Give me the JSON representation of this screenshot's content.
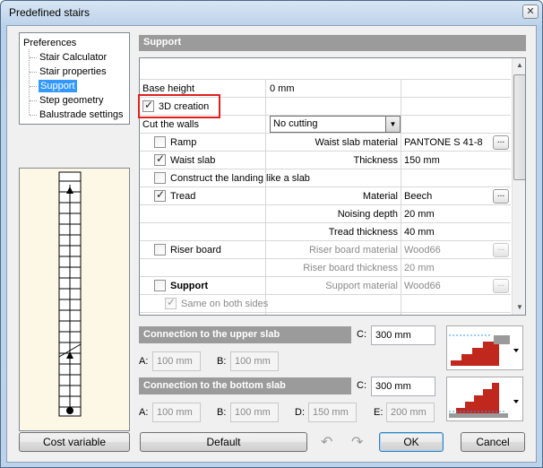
{
  "window": {
    "title": "Predefined stairs"
  },
  "tree": {
    "root": "Preferences",
    "items": [
      "Stair Calculator",
      "Stair properties",
      "Support",
      "Step geometry",
      "Balustrade settings"
    ]
  },
  "support": {
    "header": "Support",
    "rows": {
      "base_height_label": "Base height",
      "base_height_value": "0 mm",
      "creation_3d_label": "3D creation",
      "cut_walls_label": "Cut the walls",
      "cut_walls_value": "No cutting",
      "ramp_label": "Ramp",
      "waist_slab_material_label": "Waist slab material",
      "waist_slab_material_value": "PANTONE S 41-8",
      "waist_slab_label": "Waist slab",
      "thickness_label": "Thickness",
      "thickness_value": "150 mm",
      "landing_slab_label": "Construct the landing like a slab",
      "tread_label": "Tread",
      "material_label": "Material",
      "material_value": "Beech",
      "noising_depth_label": "Noising depth",
      "noising_depth_value": "20 mm",
      "tread_thickness_label": "Tread thickness",
      "tread_thickness_value": "40 mm",
      "riser_board_label": "Riser board",
      "riser_board_material_label": "Riser board material",
      "riser_board_material_value": "Wood66",
      "riser_board_thickness_label": "Riser board thickness",
      "riser_board_thickness_value": "20 mm",
      "support_label": "Support",
      "support_material_label": "Support material",
      "support_material_value": "Wood66",
      "same_both_sides_label": "Same on both sides"
    },
    "dots": "..."
  },
  "upper": {
    "header": "Connection to the upper slab",
    "c_label": "C:",
    "c_value": "300 mm",
    "a_label": "A:",
    "a_value": "100 mm",
    "b_label": "B:",
    "b_value": "100 mm"
  },
  "bottom": {
    "header": "Connection to the bottom slab",
    "c_label": "C:",
    "c_value": "300 mm",
    "a_label": "A:",
    "a_value": "100 mm",
    "b_label": "B:",
    "b_value": "100 mm",
    "d_label": "D:",
    "d_value": "150 mm",
    "e_label": "E:",
    "e_value": "200 mm"
  },
  "footer": {
    "cost_variable": "Cost variable",
    "default": "Default",
    "ok": "OK",
    "cancel": "Cancel"
  },
  "colors": {
    "accent_highlight": "#e02020",
    "selection": "#3399ff",
    "stair_red": "#c0281e"
  }
}
